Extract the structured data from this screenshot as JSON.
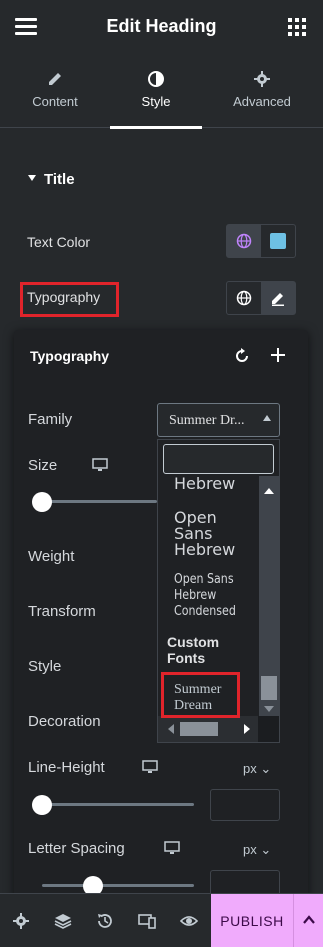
{
  "header": {
    "title": "Edit Heading",
    "menu_icon": "hamburger-icon",
    "apps_icon": "grid-icon"
  },
  "tabs": [
    {
      "label": "Content",
      "icon": "pencil-icon"
    },
    {
      "label": "Style",
      "icon": "half-circle-icon",
      "active": true
    },
    {
      "label": "Advanced",
      "icon": "gear-icon"
    }
  ],
  "section": {
    "title": "Title"
  },
  "controls": {
    "text_color_label": "Text Color",
    "typography_label": "Typography"
  },
  "typography_panel": {
    "title": "Typography",
    "family_label": "Family",
    "family_value": "Summer Dr...",
    "size_label": "Size",
    "weight_label": "Weight",
    "transform_label": "Transform",
    "style_label": "Style",
    "decoration_label": "Decoration",
    "line_height_label": "Line-Height",
    "line_height_unit": "px",
    "letter_spacing_label": "Letter Spacing",
    "letter_spacing_unit": "px"
  },
  "font_dropdown": {
    "search_value": "",
    "items": [
      {
        "label": "Hebrew"
      },
      {
        "label": "Open Sans Hebrew"
      },
      {
        "label": "Open Sans Hebrew Condensed"
      },
      {
        "label": "Custom Fonts",
        "group": true
      },
      {
        "label": "Summer Dream",
        "highlighted": true
      }
    ]
  },
  "footer": {
    "publish_label": "PUBLISH"
  },
  "colors": {
    "accent_publish": "#f0abfc",
    "highlight_box": "#e0242b",
    "text_color_swatch": "#6ec1e4"
  }
}
